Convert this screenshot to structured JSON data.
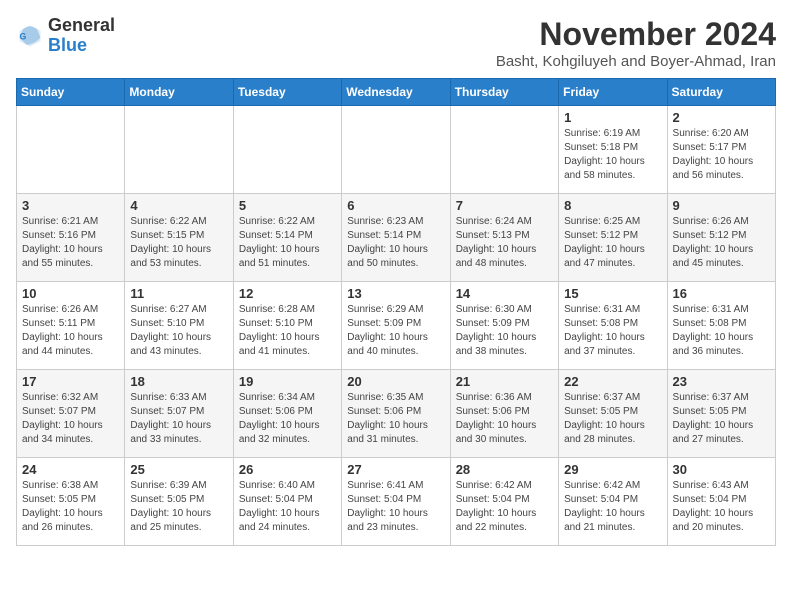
{
  "logo": {
    "general": "General",
    "blue": "Blue"
  },
  "title": "November 2024",
  "subtitle": "Basht, Kohgiluyeh and Boyer-Ahmad, Iran",
  "headers": [
    "Sunday",
    "Monday",
    "Tuesday",
    "Wednesday",
    "Thursday",
    "Friday",
    "Saturday"
  ],
  "weeks": [
    [
      {
        "day": "",
        "info": ""
      },
      {
        "day": "",
        "info": ""
      },
      {
        "day": "",
        "info": ""
      },
      {
        "day": "",
        "info": ""
      },
      {
        "day": "",
        "info": ""
      },
      {
        "day": "1",
        "info": "Sunrise: 6:19 AM\nSunset: 5:18 PM\nDaylight: 10 hours\nand 58 minutes."
      },
      {
        "day": "2",
        "info": "Sunrise: 6:20 AM\nSunset: 5:17 PM\nDaylight: 10 hours\nand 56 minutes."
      }
    ],
    [
      {
        "day": "3",
        "info": "Sunrise: 6:21 AM\nSunset: 5:16 PM\nDaylight: 10 hours\nand 55 minutes."
      },
      {
        "day": "4",
        "info": "Sunrise: 6:22 AM\nSunset: 5:15 PM\nDaylight: 10 hours\nand 53 minutes."
      },
      {
        "day": "5",
        "info": "Sunrise: 6:22 AM\nSunset: 5:14 PM\nDaylight: 10 hours\nand 51 minutes."
      },
      {
        "day": "6",
        "info": "Sunrise: 6:23 AM\nSunset: 5:14 PM\nDaylight: 10 hours\nand 50 minutes."
      },
      {
        "day": "7",
        "info": "Sunrise: 6:24 AM\nSunset: 5:13 PM\nDaylight: 10 hours\nand 48 minutes."
      },
      {
        "day": "8",
        "info": "Sunrise: 6:25 AM\nSunset: 5:12 PM\nDaylight: 10 hours\nand 47 minutes."
      },
      {
        "day": "9",
        "info": "Sunrise: 6:26 AM\nSunset: 5:12 PM\nDaylight: 10 hours\nand 45 minutes."
      }
    ],
    [
      {
        "day": "10",
        "info": "Sunrise: 6:26 AM\nSunset: 5:11 PM\nDaylight: 10 hours\nand 44 minutes."
      },
      {
        "day": "11",
        "info": "Sunrise: 6:27 AM\nSunset: 5:10 PM\nDaylight: 10 hours\nand 43 minutes."
      },
      {
        "day": "12",
        "info": "Sunrise: 6:28 AM\nSunset: 5:10 PM\nDaylight: 10 hours\nand 41 minutes."
      },
      {
        "day": "13",
        "info": "Sunrise: 6:29 AM\nSunset: 5:09 PM\nDaylight: 10 hours\nand 40 minutes."
      },
      {
        "day": "14",
        "info": "Sunrise: 6:30 AM\nSunset: 5:09 PM\nDaylight: 10 hours\nand 38 minutes."
      },
      {
        "day": "15",
        "info": "Sunrise: 6:31 AM\nSunset: 5:08 PM\nDaylight: 10 hours\nand 37 minutes."
      },
      {
        "day": "16",
        "info": "Sunrise: 6:31 AM\nSunset: 5:08 PM\nDaylight: 10 hours\nand 36 minutes."
      }
    ],
    [
      {
        "day": "17",
        "info": "Sunrise: 6:32 AM\nSunset: 5:07 PM\nDaylight: 10 hours\nand 34 minutes."
      },
      {
        "day": "18",
        "info": "Sunrise: 6:33 AM\nSunset: 5:07 PM\nDaylight: 10 hours\nand 33 minutes."
      },
      {
        "day": "19",
        "info": "Sunrise: 6:34 AM\nSunset: 5:06 PM\nDaylight: 10 hours\nand 32 minutes."
      },
      {
        "day": "20",
        "info": "Sunrise: 6:35 AM\nSunset: 5:06 PM\nDaylight: 10 hours\nand 31 minutes."
      },
      {
        "day": "21",
        "info": "Sunrise: 6:36 AM\nSunset: 5:06 PM\nDaylight: 10 hours\nand 30 minutes."
      },
      {
        "day": "22",
        "info": "Sunrise: 6:37 AM\nSunset: 5:05 PM\nDaylight: 10 hours\nand 28 minutes."
      },
      {
        "day": "23",
        "info": "Sunrise: 6:37 AM\nSunset: 5:05 PM\nDaylight: 10 hours\nand 27 minutes."
      }
    ],
    [
      {
        "day": "24",
        "info": "Sunrise: 6:38 AM\nSunset: 5:05 PM\nDaylight: 10 hours\nand 26 minutes."
      },
      {
        "day": "25",
        "info": "Sunrise: 6:39 AM\nSunset: 5:05 PM\nDaylight: 10 hours\nand 25 minutes."
      },
      {
        "day": "26",
        "info": "Sunrise: 6:40 AM\nSunset: 5:04 PM\nDaylight: 10 hours\nand 24 minutes."
      },
      {
        "day": "27",
        "info": "Sunrise: 6:41 AM\nSunset: 5:04 PM\nDaylight: 10 hours\nand 23 minutes."
      },
      {
        "day": "28",
        "info": "Sunrise: 6:42 AM\nSunset: 5:04 PM\nDaylight: 10 hours\nand 22 minutes."
      },
      {
        "day": "29",
        "info": "Sunrise: 6:42 AM\nSunset: 5:04 PM\nDaylight: 10 hours\nand 21 minutes."
      },
      {
        "day": "30",
        "info": "Sunrise: 6:43 AM\nSunset: 5:04 PM\nDaylight: 10 hours\nand 20 minutes."
      }
    ]
  ]
}
